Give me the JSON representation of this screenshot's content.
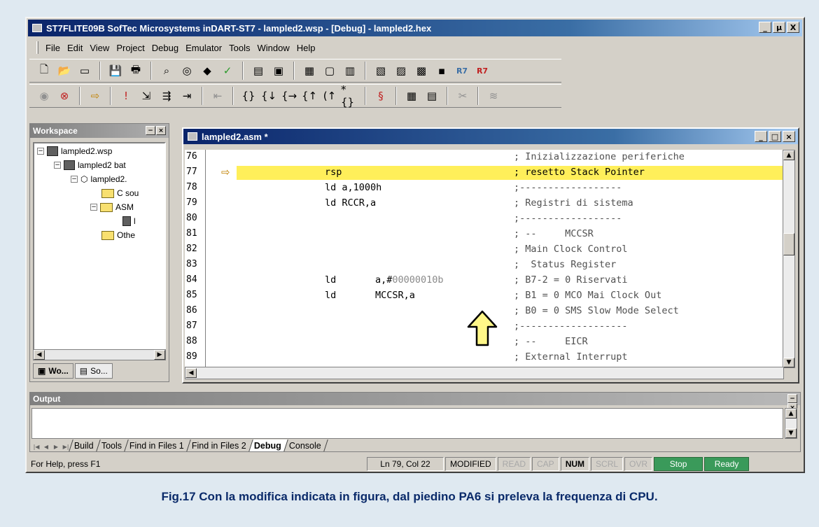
{
  "window": {
    "title": "ST7FLITE09B SofTec Microsystems  inDART-ST7 - lampled2.wsp - [Debug] - lampled2.hex",
    "controls": [
      "_",
      "µ",
      "X"
    ]
  },
  "menu": [
    "File",
    "Edit",
    "View",
    "Project",
    "Debug",
    "Emulator",
    "Tools",
    "Window",
    "Help"
  ],
  "toolbar1": [
    "new-icon",
    "open-icon",
    "window-icon",
    "save-icon",
    "print-icon",
    "find-icon",
    "binoculars-icon",
    "eraser-icon",
    "check-icon",
    "workspace-icon",
    "output-icon",
    "window-icon",
    "window-icon",
    "window-icon",
    "memory-icon",
    "register-icon",
    "watch-icon",
    "stack-icon",
    "R7",
    "R7"
  ],
  "toolbar2": [
    "run-icon",
    "stop-icon",
    "arrow-icon",
    "exclaim-icon",
    "step-icon",
    "step-icon",
    "step-icon",
    "step-icon",
    "step-icon",
    "step-icon",
    "step-icon",
    "step-icon",
    "step-icon",
    "step-icon",
    "brace-icon",
    "calc-icon",
    "calc-icon",
    "scissors-icon",
    "wave-icon"
  ],
  "workspace": {
    "title": "Workspace",
    "tree": [
      {
        "label": "lampled2.wsp",
        "level": 0,
        "type": "proj"
      },
      {
        "label": "lampled2 bat",
        "level": 1,
        "type": "proj"
      },
      {
        "label": "lampled2.",
        "level": 2,
        "type": "proj"
      },
      {
        "label": "C sou",
        "level": 3,
        "type": "folder"
      },
      {
        "label": "ASM",
        "level": 3,
        "type": "folder"
      },
      {
        "label": "l",
        "level": 4,
        "type": "file"
      },
      {
        "label": "Othe",
        "level": 3,
        "type": "folder"
      }
    ],
    "tabs": [
      "Wo...",
      "So..."
    ]
  },
  "editor": {
    "title": "lampled2.asm *",
    "lines": [
      {
        "num": "76",
        "c1": "",
        "c2": "",
        "comment": "; Inizializzazione periferiche"
      },
      {
        "num": "77",
        "c1": "rsp",
        "c2": "",
        "comment": "; resetto Stack Pointer",
        "current": true
      },
      {
        "num": "78",
        "c1": "ld a,1000h",
        "c2": "",
        "comment": ";------------------"
      },
      {
        "num": "79",
        "c1": "ld RCCR,a",
        "c2": "",
        "comment": "; Registri di sistema"
      },
      {
        "num": "80",
        "c1": "",
        "c2": "",
        "comment": ";------------------"
      },
      {
        "num": "81",
        "c1": "",
        "c2": "",
        "comment": "; --     MCCSR"
      },
      {
        "num": "82",
        "c1": "",
        "c2": "",
        "comment": "; Main Clock Control"
      },
      {
        "num": "83",
        "c1": "",
        "c2": "",
        "comment": ";  Status Register"
      },
      {
        "num": "84",
        "c1": "ld",
        "c2": "a,#",
        "c2b": "00000010b",
        "comment": "; B7-2 = 0 Riservati"
      },
      {
        "num": "85",
        "c1": "ld",
        "c2": "MCCSR,a",
        "comment": "; B1 = 0 MCO Mai Clock Out"
      },
      {
        "num": "86",
        "c1": "",
        "c2": "",
        "comment": "; B0 = 0 SMS Slow Mode Select"
      },
      {
        "num": "87",
        "c1": "",
        "c2": "",
        "comment": ";-------------------"
      },
      {
        "num": "88",
        "c1": "",
        "c2": "",
        "comment": "; --     EICR"
      },
      {
        "num": "89",
        "c1": "",
        "c2": "",
        "comment": "; External Interrupt"
      }
    ]
  },
  "output": {
    "title": "Output",
    "tabs": [
      "Build",
      "Tools",
      "Find in Files 1",
      "Find in Files 2",
      "Debug",
      "Console"
    ],
    "active_tab": "Debug"
  },
  "status": {
    "help": "For Help, press F1",
    "position": "Ln 79, Col 22",
    "modified": "MODIFIED",
    "read": "READ",
    "cap": "CAP",
    "num": "NUM",
    "scrl": "SCRL",
    "ovr": "OVR",
    "stop": "Stop",
    "ready": "Ready"
  },
  "caption": "Fig.17 Con la modifica indicata in figura, dal piedino PA6 si preleva la frequenza di CPU."
}
